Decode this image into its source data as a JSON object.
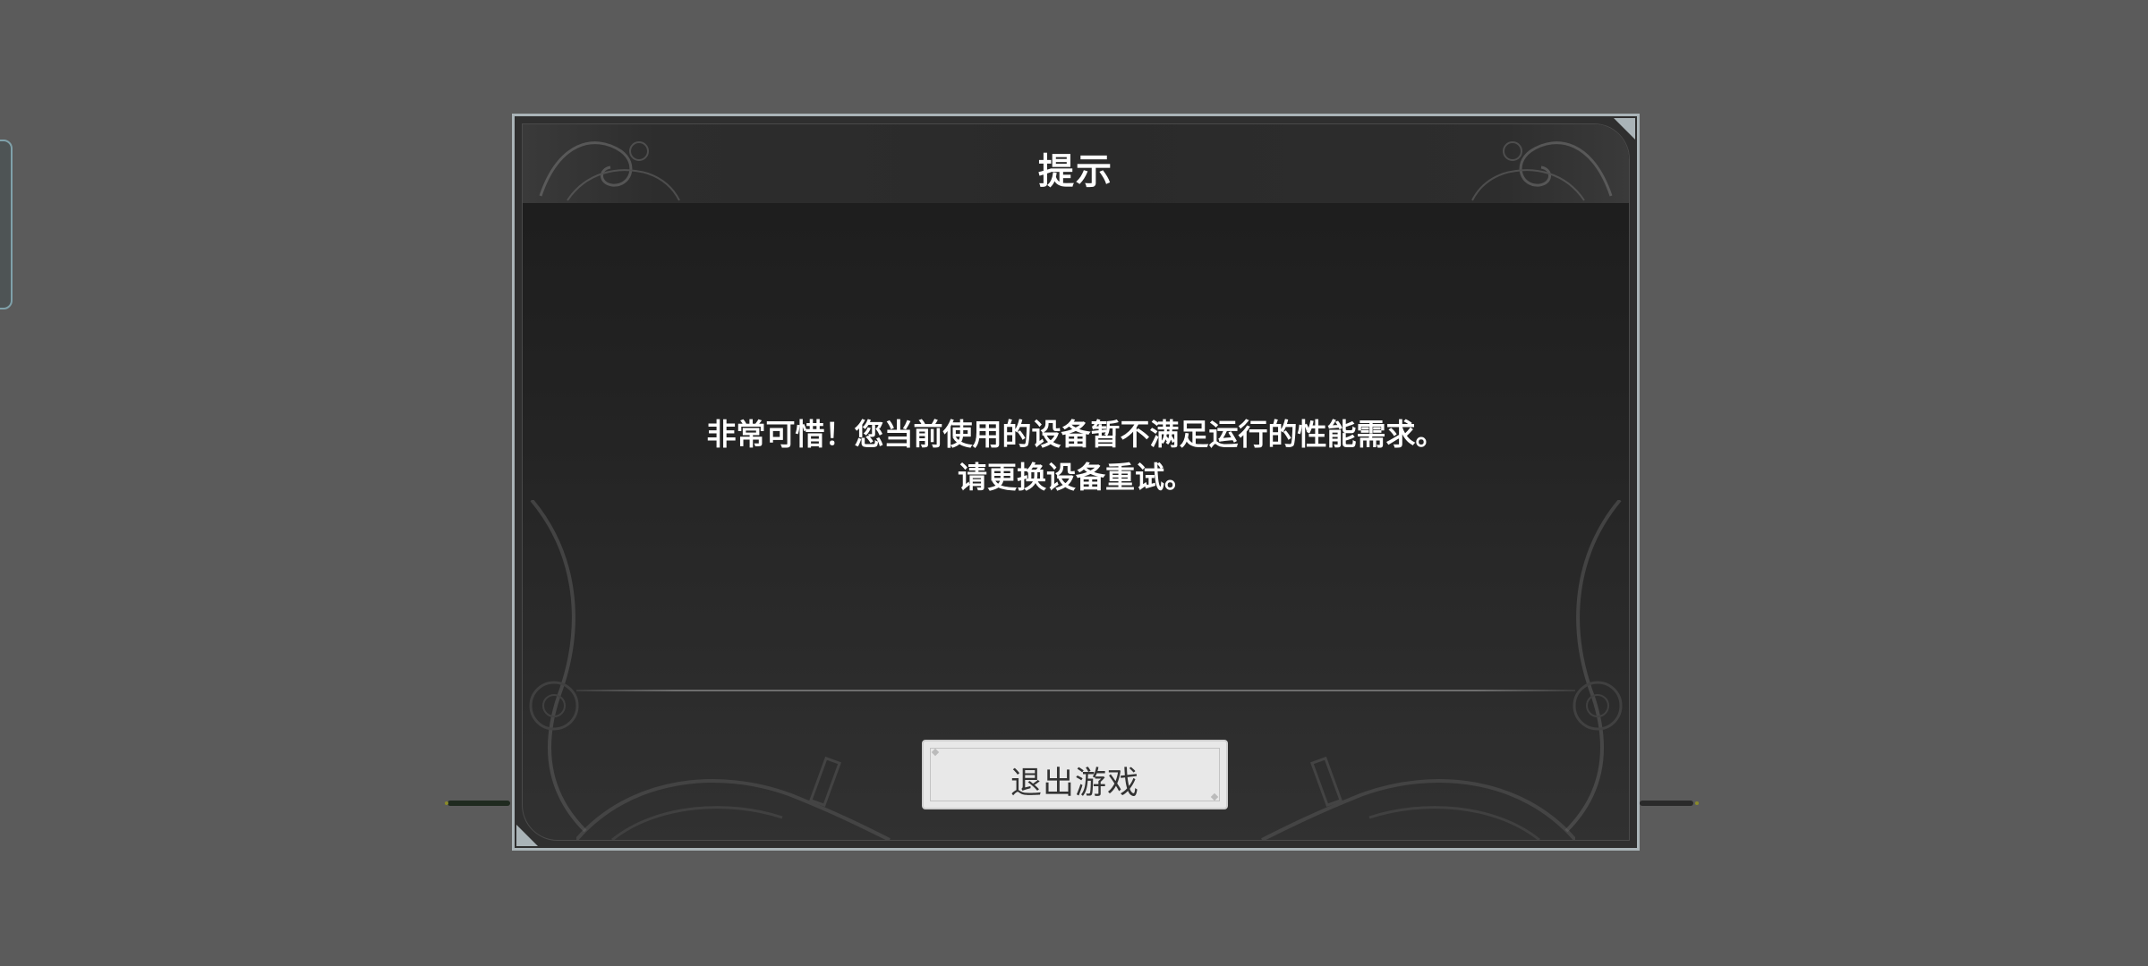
{
  "dialog": {
    "title": "提示",
    "message_line1": "非常可惜！您当前使用的设备暂不满足运行的性能需求。",
    "message_line2": "请更换设备重试。",
    "exit_button_label": "退出游戏"
  },
  "colors": {
    "page_background": "#5b5b5b",
    "dialog_border": "#aab4b8",
    "dialog_background": "#222222",
    "text": "#ffffff",
    "button_background": "#e8e8e8",
    "button_text": "#333333"
  },
  "icons": {
    "ornament": "baroque-scroll-ornament"
  }
}
